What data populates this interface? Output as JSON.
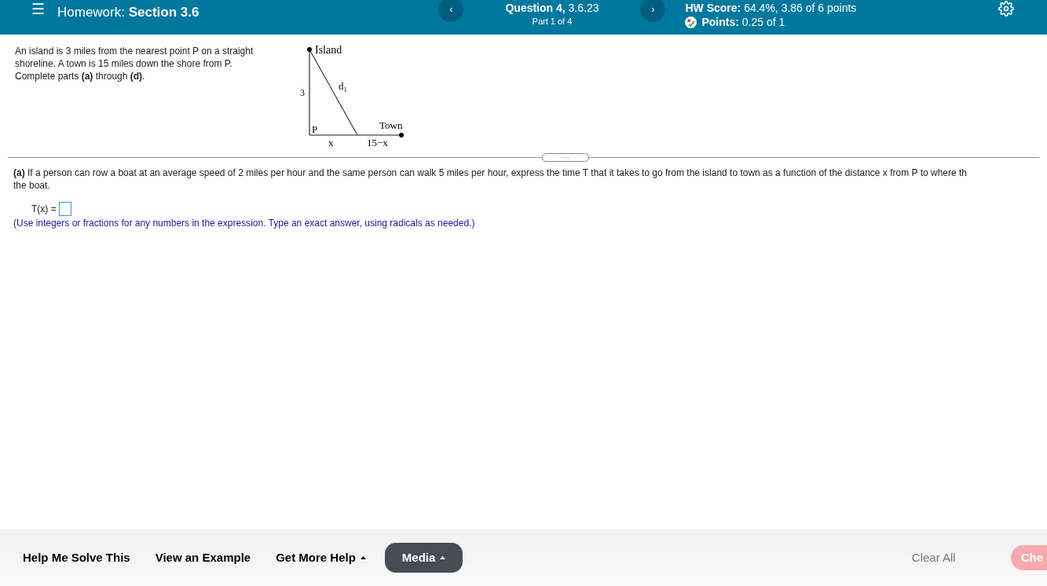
{
  "header": {
    "menu_icon": "☰",
    "prev": "‹",
    "next": "›",
    "title_prefix": "Homework:",
    "title": "Section 3.6",
    "question": {
      "label": "Question 4,",
      "number": "3.6.23",
      "part": "Part 1 of 4"
    },
    "score": {
      "label": "HW Score:",
      "value": "64.4%, 3.86 of 6 points"
    },
    "points": {
      "label": "Points:",
      "value": "0.25 of 1"
    }
  },
  "problem": {
    "text": "An island is 3 miles from the nearest point P on a straight shoreline. A town is 15 miles down the shore from P. Complete parts **(a)** through **(d)**.",
    "diagram": {
      "island": "Island",
      "side": "3",
      "hyp": "d",
      "hyp_sub": "1",
      "p": "P",
      "town": "Town",
      "x": "x",
      "rest": "15−x"
    }
  },
  "divider_handle": ".....",
  "part_a": {
    "lines": [
      "**(a)** If a person can row a boat at an average speed of 2 miles per hour and the same person can walk 5 miles per hour, express the time T that it takes to go from the island to town as a function of the distance x from P to where th",
      "the boat."
    ],
    "label": "T(x) =",
    "hint": "(Use integers or fractions for any numbers in the expression. Type an exact answer, using radicals as needed.)"
  },
  "footer": {
    "buttons": [
      {
        "label": "Help Me Solve This",
        "kind": "plain"
      },
      {
        "label": "View an Example",
        "kind": "plain"
      },
      {
        "label": "Get More Help",
        "kind": "menu"
      },
      {
        "label": "Media",
        "kind": "dark"
      }
    ],
    "clear": "Clear All",
    "check": "Che"
  }
}
